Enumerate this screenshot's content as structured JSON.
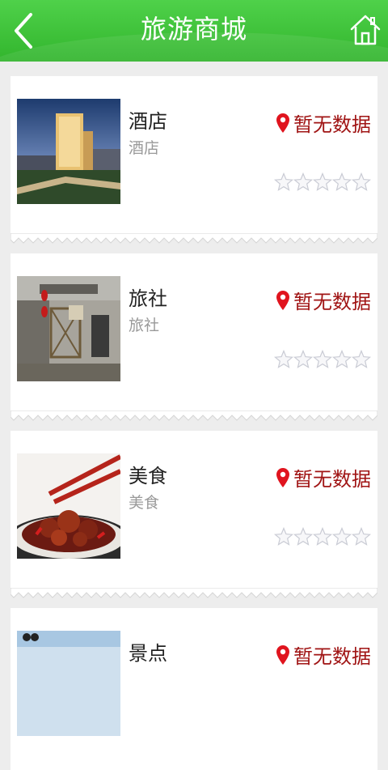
{
  "header": {
    "title": "旅游商城",
    "back_icon": "chevron-left-icon",
    "home_icon": "home-icon"
  },
  "items": [
    {
      "name": "酒店",
      "subtitle": "酒店",
      "location": "暂无数据",
      "rating": 0,
      "image": "hotel-photo"
    },
    {
      "name": "旅社",
      "subtitle": "旅社",
      "location": "暂无数据",
      "rating": 0,
      "image": "guesthouse-photo"
    },
    {
      "name": "美食",
      "subtitle": "美食",
      "location": "暂无数据",
      "rating": 0,
      "image": "food-photo"
    },
    {
      "name": "景点",
      "subtitle": "",
      "location": "暂无数据",
      "rating": 0,
      "image": "scenic-photo"
    }
  ],
  "colors": {
    "header": "#3cc437",
    "location_text": "#a01414",
    "pin": "#e0141e",
    "background": "#ededed"
  }
}
